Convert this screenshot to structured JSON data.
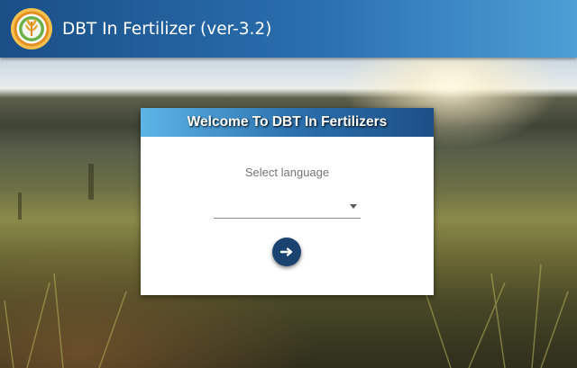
{
  "app_bar": {
    "title": "DBT In Fertilizer (ver-3.2)",
    "logo_icon": "wheat-emblem-icon"
  },
  "dialog": {
    "title": "Welcome To DBT In Fertilizers",
    "language_label": "Select language",
    "language_value": "",
    "dropdown_icon": "caret-down-icon",
    "next_icon": "arrow-right-icon"
  },
  "colors": {
    "app_bar_start": "#1a4f86",
    "app_bar_end": "#4d9fd6",
    "next_button": "#1b4370",
    "logo_ring": "#e7a12c",
    "logo_inner": "#4f9a3c"
  }
}
